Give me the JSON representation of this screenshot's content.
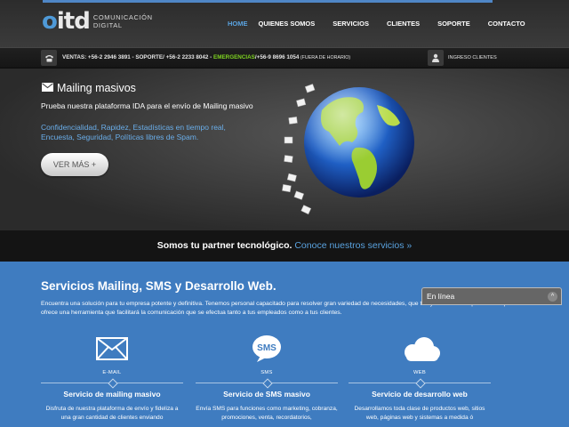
{
  "header": {
    "logo_mark": "itd",
    "logo_line1": "COMUNICACIÓN",
    "logo_line2": "DIGITAL",
    "nav": [
      "HOME",
      "QUIENES SOMOS",
      "SERVICIOS",
      "CLIENTES",
      "SOPORTE",
      "CONTACTO"
    ],
    "active_nav": "HOME",
    "accent_color": "#5aa3e0"
  },
  "contact_bar": {
    "phone_icon": "phone-icon",
    "sales": "VENTAS: +56-2 2946 3891 - ",
    "support": "SOPORTE/ +56-2 2233 8042 - ",
    "emergency_label": "EMERGENCIAS",
    "emergency_number": "/+56-9 8696 1054",
    "emergency_note": " (FUERA DE HORARIO)",
    "user_icon": "user-icon",
    "login": "INGRESO CLIENTES"
  },
  "hero": {
    "icon": "envelope-icon",
    "title": "Mailing masivos",
    "description": "Prueba nuestra plataforma IDA para el envío de Mailing masivo",
    "features": "Confidencialidad, Rapidez, Estadísticas en tiempo real, Encuesta, Seguridad, Políticas libres de Spam.",
    "button": "VER MÁS +",
    "image": "globe-with-envelopes"
  },
  "partner": {
    "text": "Somos tu partner tecnológico.",
    "link": "Conoce nuestros servicios »"
  },
  "services": {
    "title": "Servicios Mailing, SMS y Desarrollo Web.",
    "intro": "Encuentra una solución para tu empresa potente y definitiva. Tenemos personal capacitado para resolver gran variedad de necesidades, que te ayudan con una plataforma que te ofrece una herramienta que facilitará la comunicación que se efectua tanto a tus empleados como a tus clientes.",
    "items": [
      {
        "icon": "mail-icon",
        "caption": "E-MAIL",
        "name": "Servicio de mailing masivo",
        "text": "Disfruta de nuestra plataforma de envío y fideliza a una gran cantidad de clientes enviando"
      },
      {
        "icon": "sms-icon",
        "caption": "SMS",
        "name": "Servicio de SMS masivo",
        "text": "Envía SMS para funciones como marketing, cobranza, promociones, venta, recordatorios,"
      },
      {
        "icon": "cloud-icon",
        "caption": "WEB",
        "name": "Servicio de desarrollo web",
        "text": "Desarrollamos toda clase de productos web, sitios web, páginas web y sistemas a medida ó"
      }
    ]
  },
  "chat": {
    "label": "En línea",
    "toggle": "^"
  }
}
